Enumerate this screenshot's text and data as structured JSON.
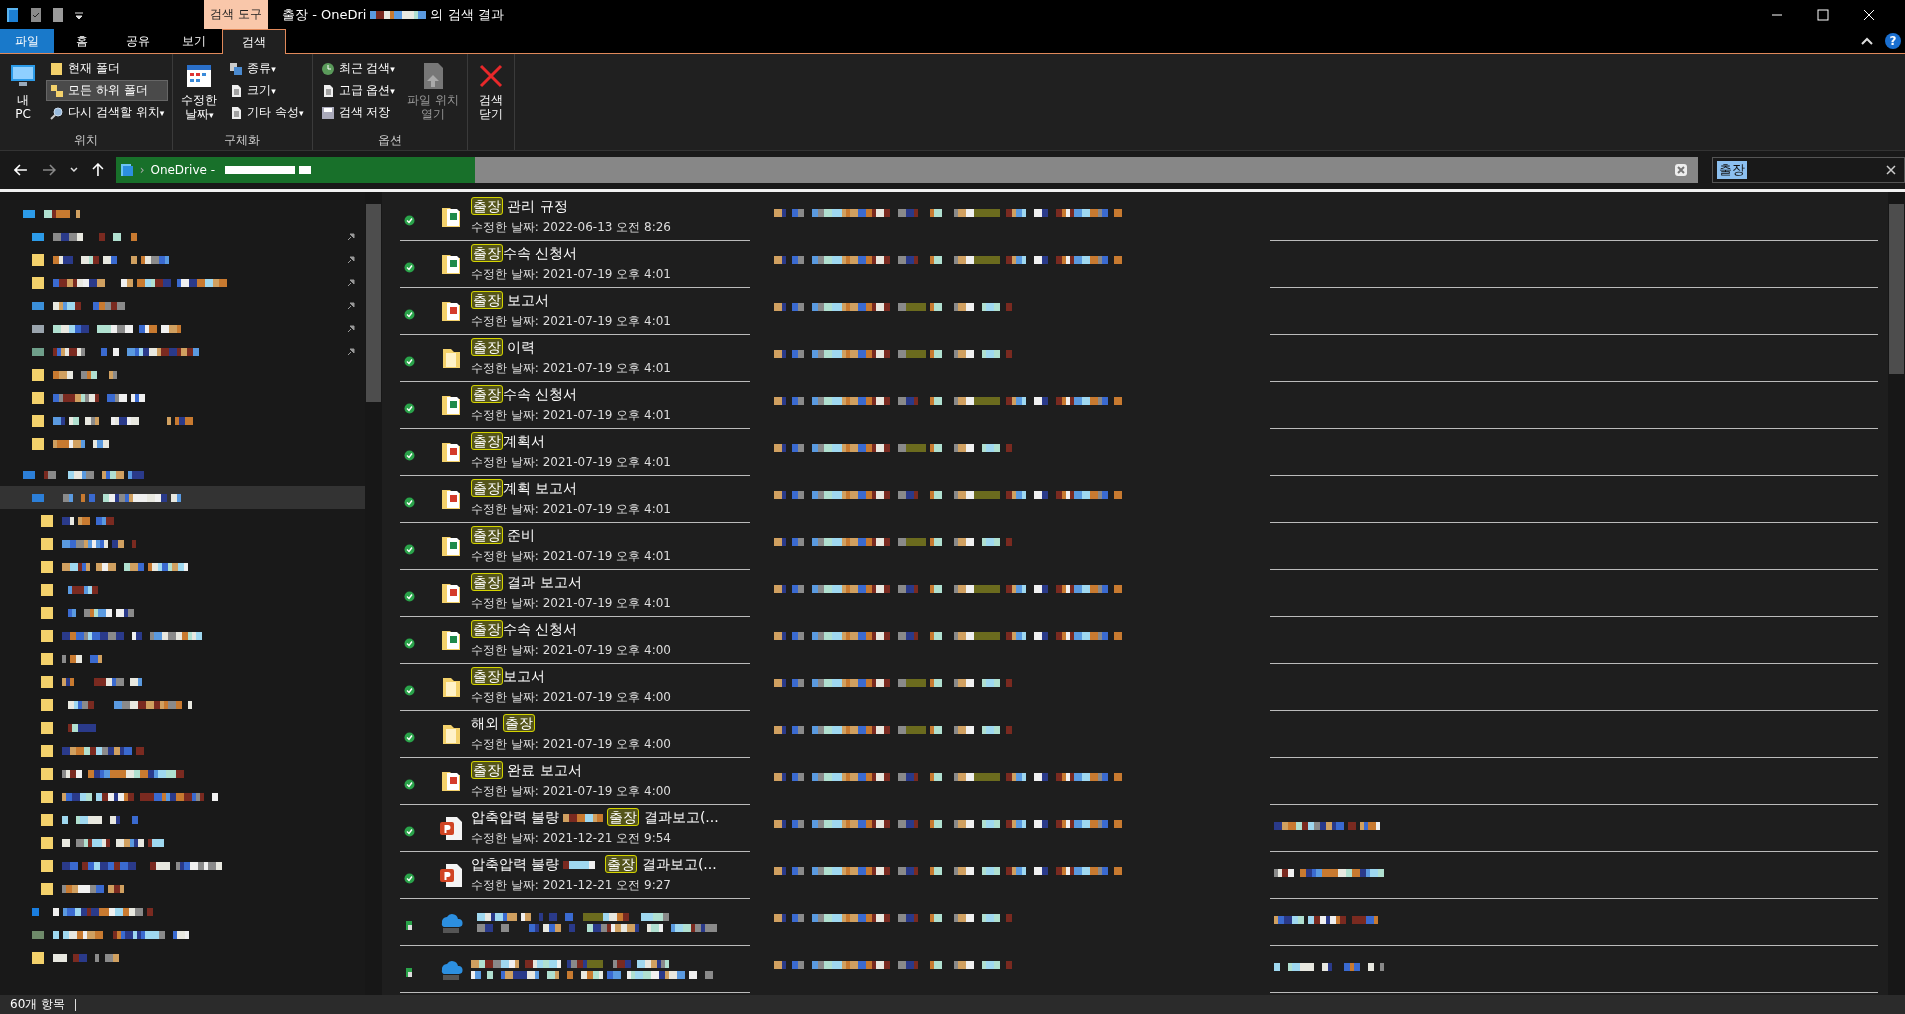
{
  "window": {
    "title_start": "출장 - OneDri",
    "title_end": "의 검색 결과",
    "context_tab": "검색 도구"
  },
  "tabs": [
    {
      "label": "파일",
      "kind": "file",
      "selected": false
    },
    {
      "label": "홈",
      "kind": "tab",
      "selected": false
    },
    {
      "label": "공유",
      "kind": "tab",
      "selected": false
    },
    {
      "label": "보기",
      "kind": "tab",
      "selected": false
    },
    {
      "label": "검색",
      "kind": "tab",
      "selected": true
    }
  ],
  "ribbon": {
    "help": "?",
    "groups": [
      {
        "label": "위치",
        "items": [
          {
            "kind": "big",
            "label": "내\nPC",
            "selected": false
          },
          {
            "kind": "col",
            "entries": [
              {
                "label": "현재 폴더",
                "selected": false
              },
              {
                "label": "모든 하위 폴더",
                "selected": true
              },
              {
                "label": "다시 검색할 위치",
                "selected": false,
                "caret": "▾"
              }
            ]
          }
        ]
      },
      {
        "label": "구체화",
        "items": [
          {
            "kind": "big",
            "label": "수정한\n날짜",
            "selected": false,
            "caret": "▾"
          },
          {
            "kind": "col",
            "entries": [
              {
                "label": "종류",
                "selected": false,
                "caret": "▾"
              },
              {
                "label": "크기",
                "selected": false,
                "caret": "▾"
              },
              {
                "label": "기타 속성",
                "selected": false,
                "caret": "▾"
              }
            ]
          }
        ]
      },
      {
        "label": "옵션",
        "items": [
          {
            "kind": "col",
            "entries": [
              {
                "label": "최근 검색",
                "selected": false,
                "caret": "▾"
              },
              {
                "label": "고급 옵션",
                "selected": false,
                "caret": "▾"
              },
              {
                "label": "검색 저장",
                "selected": false
              }
            ]
          },
          {
            "kind": "big",
            "label": "파일 위치\n열기",
            "selected": false,
            "disabled": true
          }
        ]
      },
      {
        "items": [
          {
            "kind": "big",
            "label": "검색\n닫기",
            "selected": false
          }
        ]
      }
    ]
  },
  "address": {
    "separator": "›",
    "path": "OneDrive -"
  },
  "search": {
    "value": "출장"
  },
  "sidebar": {
    "items": [
      {
        "kind": "quick",
        "selected": false,
        "children": [
          {
            "kind": "desktop",
            "pinned": true,
            "selected": false
          },
          {
            "kind": "folder",
            "pinned": true,
            "selected": false
          },
          {
            "kind": "folder",
            "pinned": true,
            "selected": false
          },
          {
            "kind": "download",
            "pinned": true,
            "selected": false
          },
          {
            "kind": "document",
            "pinned": true,
            "selected": false
          },
          {
            "kind": "image",
            "pinned": true,
            "selected": false
          },
          {
            "kind": "folder",
            "pinned": false,
            "selected": false
          },
          {
            "kind": "folder",
            "pinned": false,
            "selected": false
          },
          {
            "kind": "folder",
            "pinned": false,
            "selected": false
          },
          {
            "kind": "folder",
            "pinned": false,
            "selected": false
          }
        ]
      },
      {
        "kind": "cloud",
        "selected": false,
        "children": [
          {
            "kind": "cloud",
            "selected": true,
            "children": [
              {
                "kind": "folder",
                "selected": false
              },
              {
                "kind": "folder",
                "selected": false
              },
              {
                "kind": "folder",
                "selected": false
              },
              {
                "kind": "folder",
                "selected": false
              },
              {
                "kind": "folder",
                "selected": false
              },
              {
                "kind": "folder",
                "selected": false
              },
              {
                "kind": "folder",
                "selected": false
              },
              {
                "kind": "folder",
                "selected": false
              },
              {
                "kind": "folder",
                "selected": false
              },
              {
                "kind": "folder",
                "selected": false
              },
              {
                "kind": "folder",
                "selected": false
              },
              {
                "kind": "folder",
                "selected": false
              },
              {
                "kind": "folder",
                "selected": false
              },
              {
                "kind": "folder",
                "selected": false
              },
              {
                "kind": "folder",
                "selected": false
              },
              {
                "kind": "folder",
                "selected": false
              },
              {
                "kind": "folder",
                "selected": false
              }
            ]
          },
          {
            "kind": "phone",
            "selected": false
          },
          {
            "kind": "person",
            "selected": false
          },
          {
            "kind": "folder",
            "selected": false
          }
        ]
      }
    ]
  },
  "results": [
    {
      "kind": "excel",
      "synced": true,
      "hit": "출장",
      "post": " 관리 규정",
      "date": "수정한 날짜: 2022-06-13 오전 8:26"
    },
    {
      "kind": "excel",
      "synced": true,
      "hit": "출장",
      "post": "수속 신청서",
      "date": "수정한 날짜: 2021-07-19 오후 4:01"
    },
    {
      "kind": "pdf",
      "synced": true,
      "hit": "출장",
      "post": " 보고서",
      "date": "수정한 날짜: 2021-07-19 오후 4:01"
    },
    {
      "kind": "folder",
      "synced": true,
      "hit": "출장",
      "post": " 이력",
      "date": "수정한 날짜: 2021-07-19 오후 4:01"
    },
    {
      "kind": "excel",
      "synced": true,
      "hit": "출장",
      "post": "수속 신청서",
      "date": "수정한 날짜: 2021-07-19 오후 4:01"
    },
    {
      "kind": "pdf",
      "synced": true,
      "hit": "출장",
      "post": "계획서",
      "date": "수정한 날짜: 2021-07-19 오후 4:01"
    },
    {
      "kind": "pdf",
      "synced": true,
      "hit": "출장",
      "post": "계획 보고서",
      "date": "수정한 날짜: 2021-07-19 오후 4:01"
    },
    {
      "kind": "excel",
      "synced": true,
      "hit": "출장",
      "post": " 준비",
      "date": "수정한 날짜: 2021-07-19 오후 4:01"
    },
    {
      "kind": "pdf",
      "synced": true,
      "hit": "출장",
      "post": " 결과 보고서",
      "date": "수정한 날짜: 2021-07-19 오후 4:01"
    },
    {
      "kind": "excel",
      "synced": true,
      "hit": "출장",
      "post": "수속 신청서",
      "date": "수정한 날짜: 2021-07-19 오후 4:00"
    },
    {
      "kind": "folder",
      "synced": true,
      "hit": "출장",
      "post": "보고서",
      "date": "수정한 날짜: 2021-07-19 오후 4:00"
    },
    {
      "kind": "folder",
      "synced": true,
      "pre": "해외 ",
      "hit": "출장",
      "date": "수정한 날짜: 2021-07-19 오후 4:00"
    },
    {
      "kind": "pdf",
      "synced": true,
      "hit": "출장",
      "post": " 완료 보고서",
      "date": "수정한 날짜: 2021-07-19 오후 4:00"
    },
    {
      "kind": "ppt",
      "synced": true,
      "pre": "압축압력 불량",
      "gap": true,
      "hit": "출장",
      "post": " 결과보고(...",
      "date": "수정한 날짜: 2021-12-21 오전 9:54"
    },
    {
      "kind": "ppt",
      "synced": true,
      "pre": "압축압력 불량",
      "gap": true,
      "hit": "출장",
      "post": " 결과보고(...",
      "date": "수정한 날짜: 2021-12-21 오전 9:27"
    },
    {
      "kind": "cloud",
      "synced": false
    },
    {
      "kind": "cloud",
      "synced": false
    }
  ],
  "status_bar": {
    "count": "60개 항목"
  }
}
